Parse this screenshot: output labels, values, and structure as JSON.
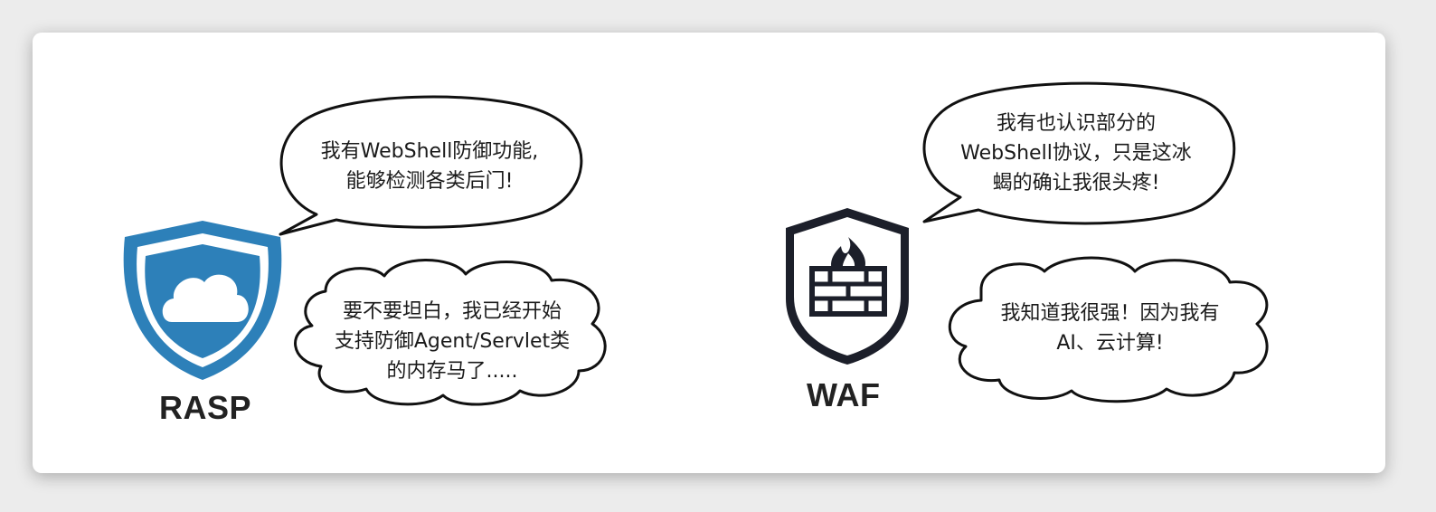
{
  "rasp": {
    "label": "RASP",
    "speech": [
      "我有WebShell防御功能,",
      "能够检测各类后门!"
    ],
    "thought": [
      "要不要坦白，我已经开始",
      "支持防御Agent/Servlet类",
      "的内存马了....."
    ],
    "color": "#2d80b9"
  },
  "waf": {
    "label": "WAF",
    "speech": [
      "我有也认识部分的",
      "WebShell协议，只是这冰",
      "蝎的确让我很头疼!"
    ],
    "thought": [
      "我知道我很强！因为我有",
      "AI、云计算!"
    ],
    "color": "#1c1f2a"
  }
}
